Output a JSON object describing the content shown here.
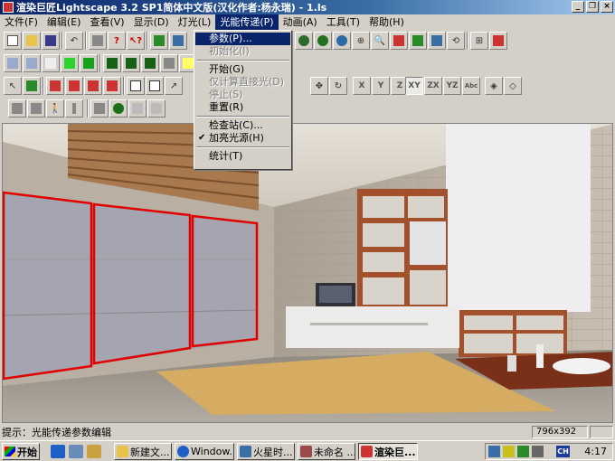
{
  "window": {
    "title": "渲染巨匠Lightscape 3.2 SP1简体中文版(汉化作者:杨永瑞) - 1.ls",
    "minimize_icon": "minimize-icon",
    "restore_icon": "restore-icon",
    "close_icon": "close-icon"
  },
  "menubar": {
    "items": [
      {
        "label": "文件(F)"
      },
      {
        "label": "编辑(E)"
      },
      {
        "label": "查看(V)"
      },
      {
        "label": "显示(D)"
      },
      {
        "label": "灯光(L)"
      },
      {
        "label": "光能传递(P)"
      },
      {
        "label": "动画(A)"
      },
      {
        "label": "工具(T)"
      },
      {
        "label": "帮助(H)"
      }
    ]
  },
  "dropdown": {
    "items": [
      {
        "label": "参数(P)...",
        "state": "selected"
      },
      {
        "label": "初始化(I)",
        "state": "disabled"
      },
      {
        "label": "",
        "state": "separator"
      },
      {
        "label": "开始(G)",
        "state": "normal"
      },
      {
        "label": "仅计算直接光(D)",
        "state": "disabled"
      },
      {
        "label": "停止(S)",
        "state": "disabled"
      },
      {
        "label": "重置(R)",
        "state": "normal"
      },
      {
        "label": "",
        "state": "separator"
      },
      {
        "label": "检查站(C)...",
        "state": "normal"
      },
      {
        "label": "加亮光源(H)",
        "state": "checked"
      },
      {
        "label": "",
        "state": "separator"
      },
      {
        "label": "统计(T)",
        "state": "normal"
      }
    ]
  },
  "toolbar": {
    "axis_buttons": [
      "X",
      "Y",
      "Z",
      "XY",
      "ZX",
      "YZ",
      "Abc"
    ]
  },
  "statusbar": {
    "hint": "提示：光能传递参数编辑",
    "size": "796x392"
  },
  "taskbar": {
    "start_label": "开始",
    "tasks": [
      {
        "label": "新建文..."
      },
      {
        "label": "Window..."
      },
      {
        "label": "火星时..."
      },
      {
        "label": "未命名 ..."
      },
      {
        "label": "渲染巨..."
      }
    ],
    "tray_lang": "CH",
    "clock": "4:17"
  },
  "colors": {
    "title_start": "#0a246a",
    "highlight": "#0a246a",
    "window_selection_outline": "#e00000",
    "face": "#d4d0c8"
  }
}
